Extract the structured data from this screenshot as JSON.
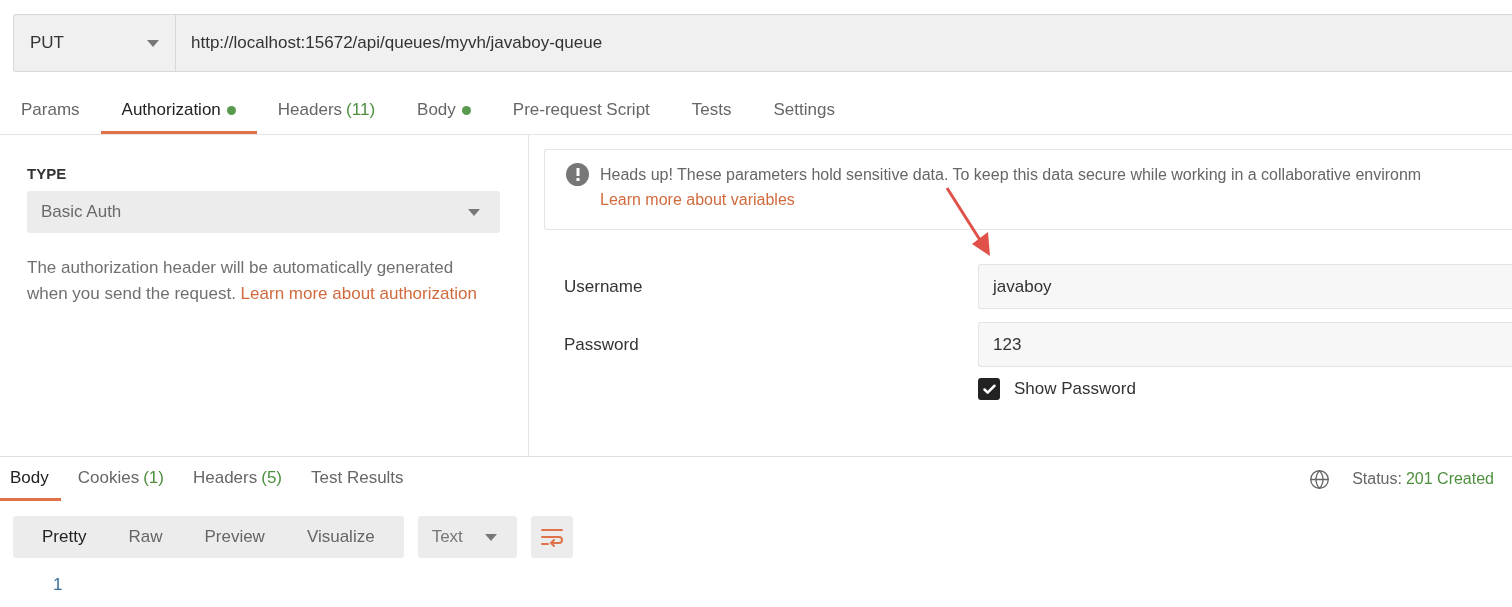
{
  "request": {
    "method": "PUT",
    "url": "http://localhost:15672/api/queues/myvh/javaboy-queue"
  },
  "request_tabs": [
    {
      "label": "Params",
      "selected": false,
      "dot": false
    },
    {
      "label": "Authorization",
      "selected": true,
      "dot": true
    },
    {
      "label": "Headers",
      "count": "(11)",
      "selected": false,
      "dot": false
    },
    {
      "label": "Body",
      "selected": false,
      "dot": true
    },
    {
      "label": "Pre-request Script",
      "selected": false,
      "dot": false
    },
    {
      "label": "Tests",
      "selected": false,
      "dot": false
    },
    {
      "label": "Settings",
      "selected": false,
      "dot": false
    }
  ],
  "auth": {
    "type_label": "TYPE",
    "type": "Basic Auth",
    "description": "The authorization header will be automatically generated when you send the request.",
    "learn_link": "Learn more about authorization"
  },
  "notice": {
    "text": "Heads up! These parameters hold sensitive data. To keep this data secure while working in a collaborative environm",
    "link": "Learn more about variables"
  },
  "fields": [
    {
      "label": "Username",
      "value": "javaboy"
    },
    {
      "label": "Password",
      "value": "123"
    }
  ],
  "show_password": {
    "label": "Show Password",
    "checked": true
  },
  "response_tabs": [
    {
      "label": "Body",
      "selected": true
    },
    {
      "label": "Cookies",
      "count": "(1)",
      "selected": false
    },
    {
      "label": "Headers",
      "count": "(5)",
      "selected": false
    },
    {
      "label": "Test Results",
      "selected": false
    }
  ],
  "status": {
    "label": "Status:",
    "value": "201 Created"
  },
  "formats": [
    {
      "label": "Pretty",
      "selected": true
    },
    {
      "label": "Raw",
      "selected": false
    },
    {
      "label": "Preview",
      "selected": false
    },
    {
      "label": "Visualize",
      "selected": false
    }
  ],
  "language": "Text",
  "line_numbers": [
    "1"
  ]
}
